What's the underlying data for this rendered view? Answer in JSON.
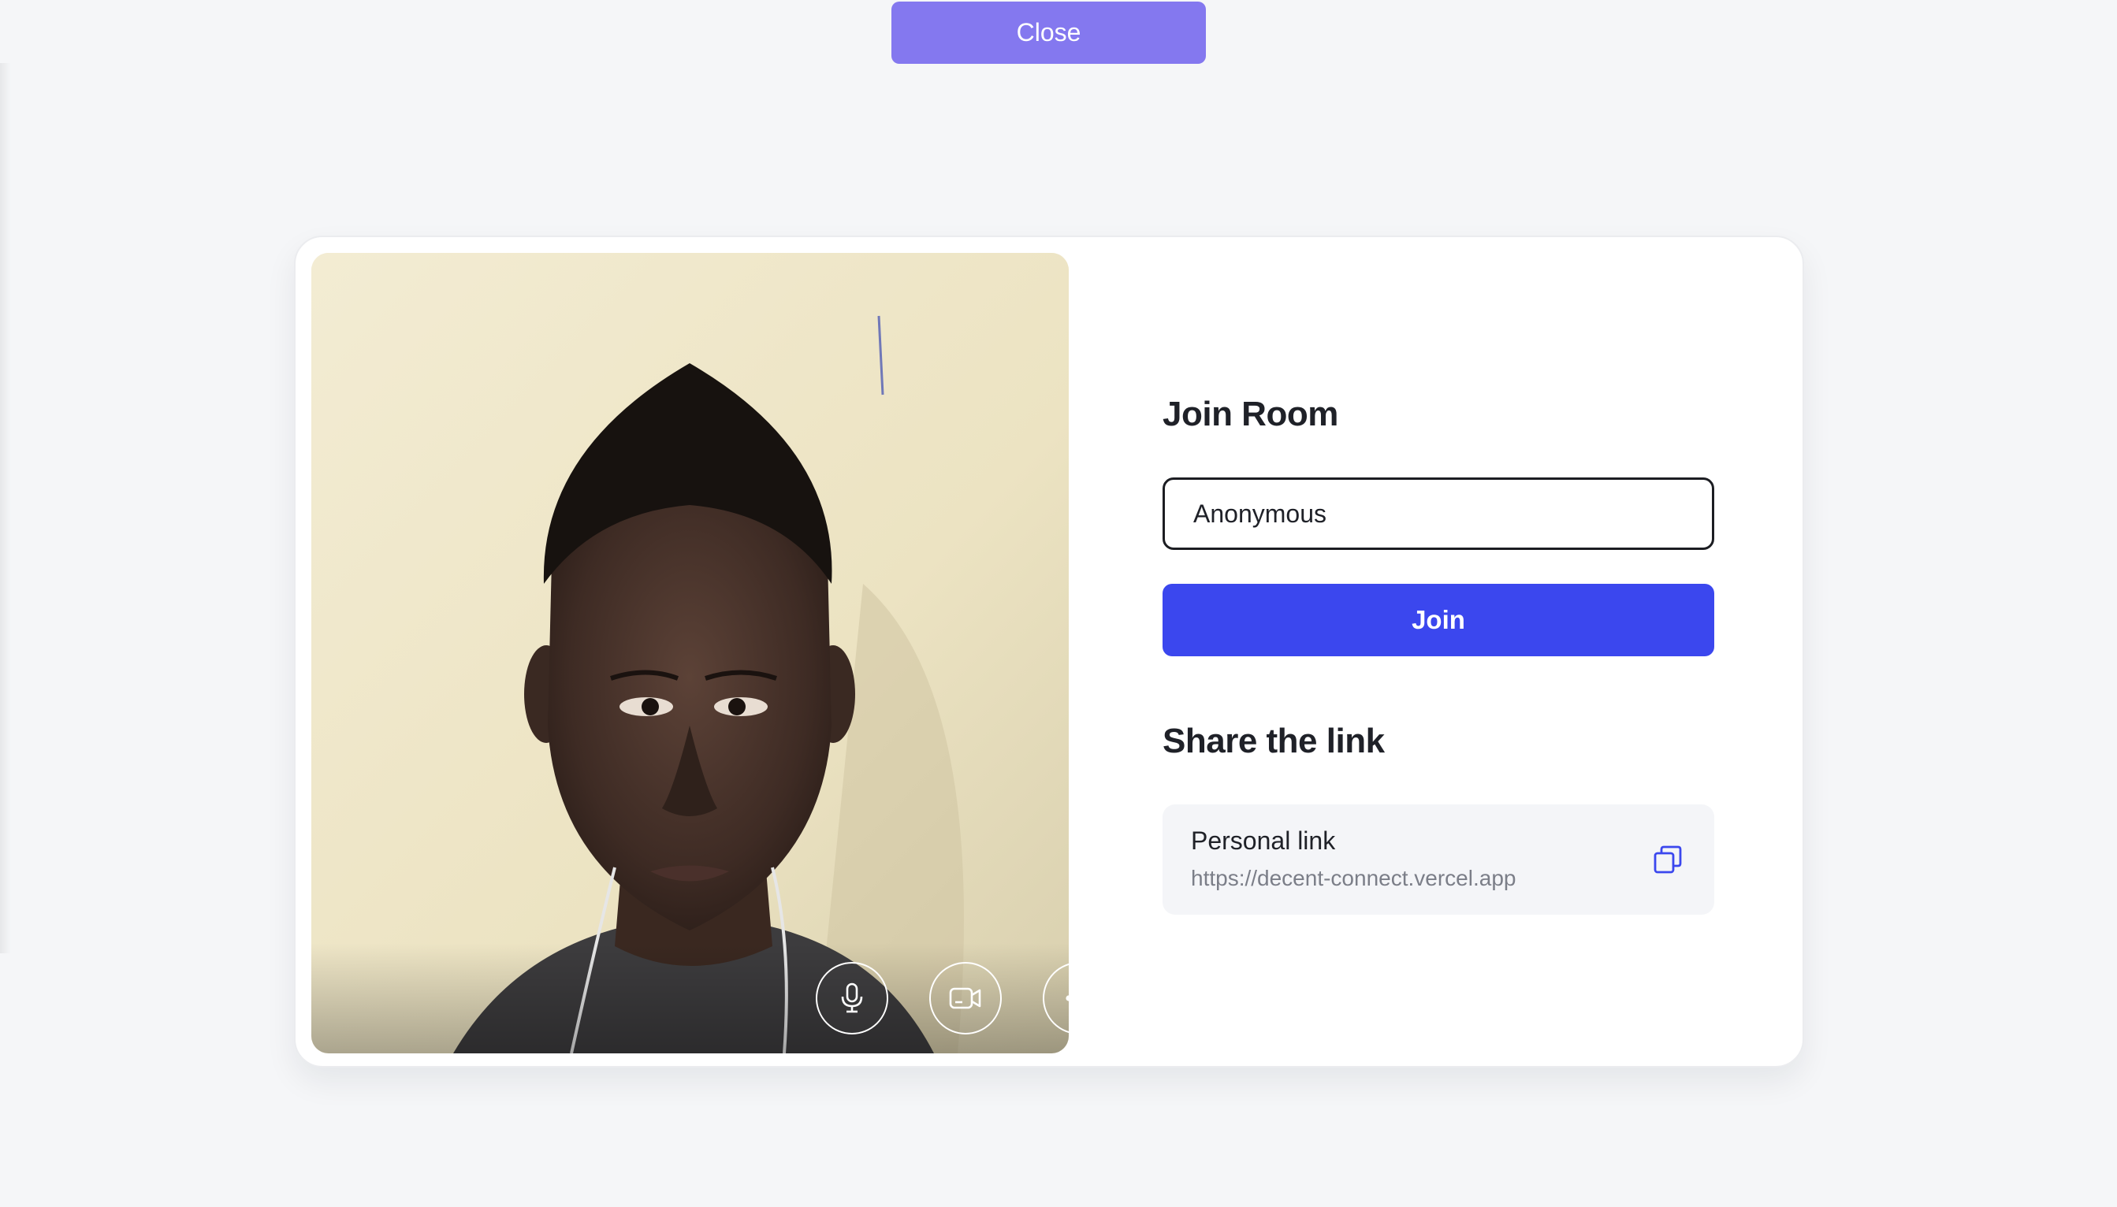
{
  "header": {
    "close_label": "Close"
  },
  "video_preview": {
    "controls": [
      {
        "icon": "microphone-icon"
      },
      {
        "icon": "video-camera-icon"
      },
      {
        "icon": "more-options-icon"
      }
    ]
  },
  "join": {
    "title": "Join Room",
    "name_value": "Anonymous",
    "join_label": "Join"
  },
  "share": {
    "title": "Share the link",
    "link_label": "Personal link",
    "link_url": "https://decent-connect.vercel.app",
    "copy_icon": "copy-icon"
  },
  "colors": {
    "background": "#f5f6f8",
    "close_button": "#8478ef",
    "join_button": "#3b47ee",
    "link_box": "#f4f5f8",
    "copy_icon": "#3b47ee"
  }
}
